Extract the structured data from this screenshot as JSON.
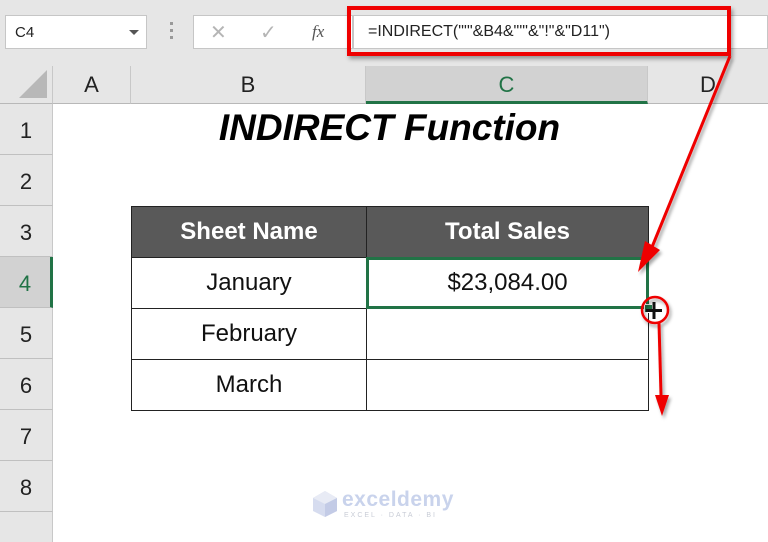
{
  "toolbar": {
    "name_box": "C4",
    "cancel_icon": "✕",
    "enter_icon": "✓",
    "fx_label": "fx",
    "formula": "=INDIRECT(\"'\"&B4&\"'\"&\"!\"&\"D11\")"
  },
  "grid": {
    "columns": [
      "A",
      "B",
      "C",
      "D"
    ],
    "rows": [
      "1",
      "2",
      "3",
      "4",
      "5",
      "6",
      "7",
      "8"
    ],
    "selected_column": "C",
    "selected_row": "4"
  },
  "sheet": {
    "title": "INDIRECT Function",
    "table": {
      "headers": [
        "Sheet Name",
        "Total Sales"
      ],
      "rows": [
        [
          "January",
          "$23,084.00"
        ],
        [
          "February",
          ""
        ],
        [
          "March",
          ""
        ]
      ]
    }
  },
  "annotations": {
    "color": "#ef0000",
    "cursor": "fill-handle-crosshair"
  },
  "watermark": {
    "name": "exceldemy",
    "tagline": "EXCEL · DATA · BI"
  }
}
